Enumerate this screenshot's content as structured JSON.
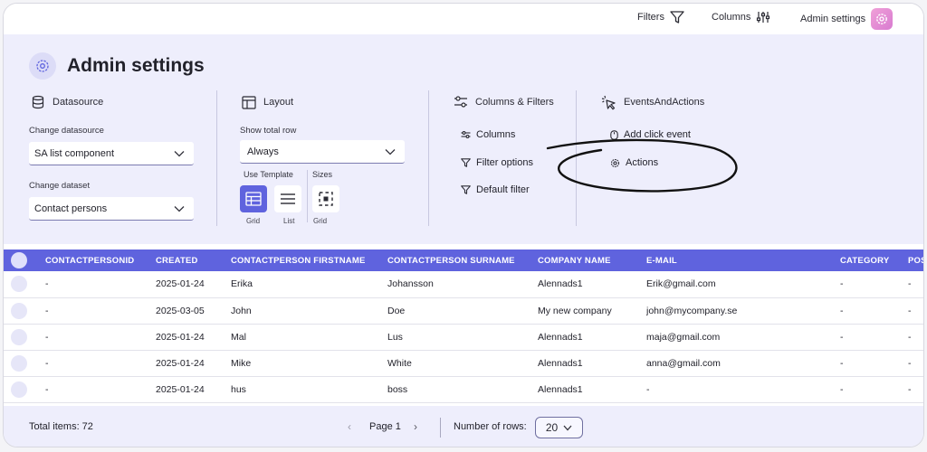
{
  "topbar": {
    "filters_label": "Filters",
    "columns_label": "Columns",
    "admin_label": "Admin settings"
  },
  "header": {
    "title": "Admin settings"
  },
  "datasource": {
    "heading": "Datasource",
    "change_datasource_label": "Change datasource",
    "datasource_value": "SA list component",
    "change_dataset_label": "Change dataset",
    "dataset_value": "Contact persons"
  },
  "layout": {
    "heading": "Layout",
    "show_total_row_label": "Show total row",
    "show_total_row_value": "Always",
    "use_template_label": "Use Template",
    "sizes_label": "Sizes",
    "template_grid_caption": "Grid",
    "template_list_caption": "List",
    "sizes_grid_caption": "Grid"
  },
  "columns_filters": {
    "heading": "Columns & Filters",
    "items": [
      "Columns",
      "Filter options",
      "Default filter"
    ]
  },
  "events": {
    "heading": "EventsAndActions",
    "items": [
      "Add click event",
      "Actions"
    ]
  },
  "table": {
    "columns": [
      "CONTACTPERSONID",
      "CREATED",
      "CONTACTPERSON FIRSTNAME",
      "CONTACTPERSON SURNAME",
      "COMPANY NAME",
      "E-MAIL",
      "CATEGORY",
      "POS"
    ],
    "rows": [
      [
        "-",
        "2025-01-24",
        "Erika",
        "Johansson",
        "Alennads1",
        "Erik@gmail.com",
        "-",
        "-"
      ],
      [
        "-",
        "2025-03-05",
        "John",
        "Doe",
        "My new company",
        "john@mycompany.se",
        "-",
        "-"
      ],
      [
        "-",
        "2025-01-24",
        "Mal",
        "Lus",
        "Alennads1",
        "maja@gmail.com",
        "-",
        "-"
      ],
      [
        "-",
        "2025-01-24",
        "Mike",
        "White",
        "Alennads1",
        "anna@gmail.com",
        "-",
        "-"
      ],
      [
        "-",
        "2025-01-24",
        "hus",
        "boss",
        "Alennads1",
        "-",
        "-",
        "-"
      ]
    ]
  },
  "footer": {
    "total_items": "Total items:  72",
    "page_label": "Page 1",
    "rows_label": "Number of rows:",
    "rows_value": "20"
  },
  "colors": {
    "accent": "#5f63de",
    "panel_bg": "#eeeefc",
    "avatar_pink": "#e08ad6"
  }
}
